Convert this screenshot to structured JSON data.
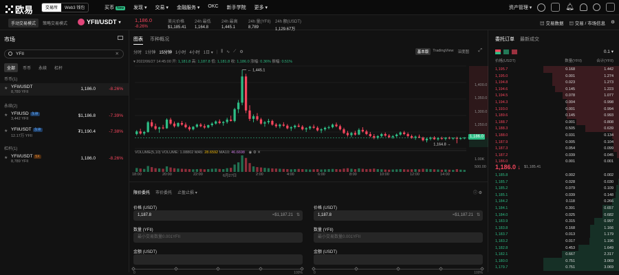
{
  "header": {
    "logo_text": "欧易",
    "toggle": [
      "交易所",
      "Web3 钱包"
    ],
    "nav": [
      "买币",
      "发现",
      "交易",
      "金融服务",
      "OKC",
      "新手学院",
      "更多"
    ],
    "nav_new_badge": "New",
    "right": [
      "资产管理"
    ]
  },
  "ticker": {
    "mode_active": "手动交易模式",
    "mode_other": "策略交易模式",
    "pair": "YFII/USDT",
    "last_price": "1,186.0",
    "change": "-8.26%",
    "stats": [
      {
        "k": "美元价格",
        "v": "$1,185.41"
      },
      {
        "k": "24h 最低",
        "v": "1,164.8"
      },
      {
        "k": "24h 最高",
        "v": "1,445.1"
      },
      {
        "k": "24h 量(YFII)",
        "v": "8,789"
      },
      {
        "k": "24h 额(USDT)",
        "v": "1,129.67万"
      }
    ],
    "links": [
      "交易数据",
      "交易 / 市场信息"
    ]
  },
  "market": {
    "title": "市场",
    "search_value": "YFII",
    "tabs": [
      "全部",
      "币币",
      "永续",
      "杠杆"
    ],
    "sections": [
      {
        "title": "币币(1)",
        "items": [
          {
            "name": "YFII/USDT",
            "tag": "",
            "vol": "8,789 YFII",
            "price": "1,186.0",
            "change": "-8.26%"
          }
        ]
      },
      {
        "title": "永续(2)",
        "items": [
          {
            "name": "YFIIUSD",
            "tag": "永续",
            "vol": "3,442 YFII",
            "price": "$1,186.8",
            "change": "-7.39%"
          },
          {
            "name": "YFIIUSDT",
            "tag": "永续",
            "vol": "12.17万 YFII",
            "price": "₮1,190.4",
            "change": "-7.38%"
          }
        ]
      },
      {
        "title": "杠杆(1)",
        "items": [
          {
            "name": "YFII/USDT",
            "tag": "5X",
            "vol": "8,789 YFII",
            "price": "1,186.0",
            "change": "-8.26%"
          }
        ]
      }
    ]
  },
  "chart": {
    "tabs": [
      "图表",
      "币种概况"
    ],
    "timeframes": [
      "分时",
      "1分钟",
      "15分钟",
      "1小时",
      "4小时",
      "1日"
    ],
    "views": [
      "基本版",
      "TradingView",
      "深度图"
    ],
    "ohlc_line": {
      "date": "2022/06/27 14:45:00",
      "open_k": "开",
      "open": "1,181.8",
      "high_k": "高",
      "high": "1,187.8",
      "low_k": "低",
      "low": "1,181.8",
      "close_k": "收",
      "close": "1,186.0",
      "chg_k": "涨幅",
      "chg": "0.36%",
      "amp_k": "振幅",
      "amp": "0.51%"
    },
    "vol_line": {
      "label": "VOLUME(5,10)",
      "vol_k": "VOLUME",
      "vol": "1.08802",
      "ma5_k": "MA5",
      "ma5": "28.6592",
      "ma10_k": "MA10",
      "ma10": "46.6698"
    },
    "high_marker": "1,445.1",
    "low_marker": "1,164.8",
    "current_price": "1,186.0",
    "price_ticks": [
      "1,400.0",
      "1,350.0",
      "1,300.0",
      "1,250.0",
      "1,200.0"
    ],
    "vol_ticks": [
      "1.00K",
      "500.00"
    ],
    "time_ticks": [
      "18:00",
      "20:00",
      "22:00",
      "6月27日",
      "2:00",
      "4:00",
      "6:00",
      "8:00",
      "10:00",
      "12:00",
      "14:00"
    ]
  },
  "chart_data": {
    "type": "candlestick",
    "title": "",
    "ylim": [
      1150,
      1460
    ],
    "candles": [
      [
        1200,
        1215,
        1195,
        1210
      ],
      [
        1210,
        1220,
        1198,
        1202
      ],
      [
        1202,
        1212,
        1195,
        1208
      ],
      [
        1208,
        1250,
        1205,
        1245
      ],
      [
        1245,
        1255,
        1225,
        1230
      ],
      [
        1230,
        1240,
        1215,
        1220
      ],
      [
        1220,
        1228,
        1205,
        1225
      ],
      [
        1225,
        1235,
        1218,
        1222
      ],
      [
        1222,
        1260,
        1220,
        1255
      ],
      [
        1255,
        1262,
        1235,
        1240
      ],
      [
        1240,
        1248,
        1225,
        1230
      ],
      [
        1230,
        1245,
        1226,
        1242
      ],
      [
        1242,
        1250,
        1232,
        1236
      ],
      [
        1236,
        1244,
        1222,
        1226
      ],
      [
        1226,
        1232,
        1212,
        1218
      ],
      [
        1218,
        1230,
        1214,
        1228
      ],
      [
        1228,
        1240,
        1224,
        1236
      ],
      [
        1236,
        1242,
        1226,
        1230
      ],
      [
        1230,
        1238,
        1220,
        1225
      ],
      [
        1225,
        1236,
        1222,
        1234
      ],
      [
        1234,
        1245,
        1228,
        1240
      ],
      [
        1240,
        1252,
        1236,
        1248
      ],
      [
        1248,
        1256,
        1238,
        1242
      ],
      [
        1242,
        1250,
        1232,
        1246
      ],
      [
        1246,
        1262,
        1240,
        1255
      ],
      [
        1255,
        1270,
        1248,
        1250
      ],
      [
        1250,
        1300,
        1245,
        1295
      ],
      [
        1295,
        1330,
        1280,
        1320
      ],
      [
        1320,
        1445,
        1310,
        1420
      ],
      [
        1420,
        1430,
        1280,
        1290
      ],
      [
        1290,
        1310,
        1250,
        1258
      ],
      [
        1258,
        1275,
        1245,
        1268
      ],
      [
        1268,
        1280,
        1250,
        1256
      ],
      [
        1256,
        1262,
        1236,
        1240
      ],
      [
        1240,
        1250,
        1228,
        1245
      ],
      [
        1245,
        1258,
        1238,
        1250
      ],
      [
        1250,
        1255,
        1232,
        1236
      ],
      [
        1236,
        1242,
        1224,
        1230
      ],
      [
        1230,
        1240,
        1222,
        1236
      ],
      [
        1236,
        1245,
        1228,
        1232
      ],
      [
        1232,
        1238,
        1218,
        1222
      ],
      [
        1222,
        1230,
        1212,
        1226
      ],
      [
        1226,
        1236,
        1220,
        1232
      ],
      [
        1232,
        1240,
        1226,
        1228
      ],
      [
        1228,
        1234,
        1214,
        1218
      ],
      [
        1218,
        1226,
        1208,
        1222
      ],
      [
        1222,
        1232,
        1216,
        1228
      ],
      [
        1228,
        1236,
        1220,
        1224
      ],
      [
        1224,
        1230,
        1210,
        1214
      ],
      [
        1214,
        1222,
        1204,
        1218
      ],
      [
        1218,
        1228,
        1212,
        1224
      ],
      [
        1224,
        1232,
        1218,
        1226
      ],
      [
        1226,
        1240,
        1222,
        1236
      ],
      [
        1236,
        1244,
        1226,
        1230
      ],
      [
        1230,
        1236,
        1214,
        1218
      ],
      [
        1218,
        1224,
        1200,
        1204
      ],
      [
        1204,
        1212,
        1190,
        1196
      ],
      [
        1196,
        1208,
        1188,
        1204
      ],
      [
        1204,
        1212,
        1194,
        1198
      ],
      [
        1198,
        1222,
        1196,
        1216
      ],
      [
        1216,
        1226,
        1206,
        1210
      ],
      [
        1210,
        1216,
        1196,
        1200
      ],
      [
        1200,
        1208,
        1188,
        1192
      ],
      [
        1192,
        1200,
        1180,
        1186
      ],
      [
        1186,
        1196,
        1180,
        1192
      ],
      [
        1192,
        1204,
        1186,
        1200
      ],
      [
        1200,
        1206,
        1190,
        1194
      ],
      [
        1194,
        1200,
        1184,
        1188
      ],
      [
        1188,
        1196,
        1182,
        1192
      ],
      [
        1192,
        1202,
        1188,
        1198
      ],
      [
        1198,
        1210,
        1194,
        1206
      ],
      [
        1206,
        1212,
        1196,
        1200
      ],
      [
        1200,
        1206,
        1188,
        1192
      ],
      [
        1192,
        1198,
        1182,
        1186
      ],
      [
        1186,
        1194,
        1178,
        1190
      ],
      [
        1190,
        1198,
        1184,
        1186
      ],
      [
        1186,
        1190,
        1172,
        1176
      ],
      [
        1176,
        1186,
        1168,
        1182
      ],
      [
        1182,
        1190,
        1176,
        1186
      ],
      [
        1186,
        1192,
        1178,
        1180
      ],
      [
        1180,
        1188,
        1175,
        1184
      ],
      [
        1184,
        1190,
        1178,
        1182
      ],
      [
        1182,
        1188,
        1176,
        1186
      ],
      [
        1186,
        1190,
        1180,
        1183
      ],
      [
        1183,
        1187,
        1178,
        1185
      ],
      [
        1185,
        1190,
        1164.8,
        1182
      ],
      [
        1182,
        1188,
        1178,
        1184
      ],
      [
        1184,
        1188,
        1180,
        1186
      ]
    ],
    "volume": [
      210,
      180,
      160,
      320,
      260,
      200,
      190,
      170,
      300,
      240,
      200,
      180,
      170,
      160,
      150,
      140,
      150,
      160,
      140,
      150,
      170,
      180,
      160,
      150,
      200,
      220,
      400,
      520,
      900,
      760,
      480,
      300,
      260,
      240,
      220,
      200,
      190,
      180,
      170,
      160,
      150,
      140,
      150,
      160,
      150,
      140,
      130,
      140,
      150,
      130,
      140,
      150,
      160,
      150,
      140,
      180,
      200,
      170,
      150,
      190,
      170,
      150,
      160,
      180,
      150,
      140,
      130,
      120,
      130,
      140,
      150,
      140,
      130,
      140,
      150,
      140,
      170,
      160,
      150,
      140,
      130,
      120,
      130,
      120,
      110,
      150,
      120,
      110
    ]
  },
  "order": {
    "tabs": [
      "限价委托",
      "市价委托",
      "止盈止损"
    ],
    "buy": {
      "price_label": "价格 (USDT)",
      "price": "1,187.8",
      "price_usd": "≈$1,187.21",
      "qty_label": "数量 (YFII)",
      "qty_placeholder": "最小交易数量0.001YFII",
      "amt_label": "金额 (USDT)"
    },
    "sell": {
      "price_label": "价格 (USDT)",
      "price": "1,187.8",
      "price_usd": "≈$1,187.21",
      "qty_label": "数量 (YFII)",
      "qty_placeholder": "最小交易数量0.001YFII",
      "amt_label": "金额 (USDT)"
    },
    "slider_min": "0",
    "slider_max": "100%"
  },
  "book": {
    "tabs": [
      "委托订单",
      "最新成交"
    ],
    "precision": "0.1",
    "headers": [
      "价格(USDT)",
      "数量(YFII)",
      "合计(YFII)"
    ],
    "asks": [
      [
        "1,195.7",
        "0.168",
        "1.442"
      ],
      [
        "1,195.0",
        "0.001",
        "1.274"
      ],
      [
        "1,194.8",
        "0.023",
        "1.273"
      ],
      [
        "1,194.6",
        "0.145",
        "1.223"
      ],
      [
        "1,194.5",
        "0.078",
        "1.077"
      ],
      [
        "1,194.3",
        "0.004",
        "0.998"
      ],
      [
        "1,193.0",
        "0.001",
        "0.994"
      ],
      [
        "1,189.6",
        "0.145",
        "0.993"
      ],
      [
        "1,188.7",
        "0.001",
        "0.808"
      ],
      [
        "1,188.3",
        "0.505",
        "0.639"
      ],
      [
        "1,188.0",
        "0.031",
        "0.134"
      ],
      [
        "1,187.9",
        "0.005",
        "0.104"
      ],
      [
        "1,187.3",
        "0.054",
        "0.099"
      ],
      [
        "1,187.2",
        "0.039",
        "0.045"
      ],
      [
        "1,186.0",
        "0.001",
        "0.001"
      ]
    ],
    "mid_price": "1,186.0",
    "mid_usd": "$1,185.41",
    "bids": [
      [
        "1,185.8",
        "0.002",
        "0.002"
      ],
      [
        "1,185.7",
        "0.028",
        "0.030"
      ],
      [
        "1,185.2",
        "0.079",
        "0.109"
      ],
      [
        "1,185.1",
        "0.039",
        "0.148"
      ],
      [
        "1,184.2",
        "0.118",
        "0.266"
      ],
      [
        "1,184.1",
        "0.391",
        "0.657"
      ],
      [
        "1,184.0",
        "0.025",
        "0.682"
      ],
      [
        "1,183.9",
        "0.315",
        "0.997"
      ],
      [
        "1,183.8",
        "0.168",
        "1.166"
      ],
      [
        "1,183.7",
        "0.013",
        "1.179"
      ],
      [
        "1,183.2",
        "0.017",
        "1.196"
      ],
      [
        "1,182.8",
        "0.453",
        "1.649"
      ],
      [
        "1,182.1",
        "0.667",
        "2.317"
      ],
      [
        "1,180.0",
        "0.751",
        "3.069"
      ],
      [
        "1,179.7",
        "0.751",
        "3.069"
      ]
    ]
  },
  "colors": {
    "up": "#2ebd85",
    "down": "#f6465d",
    "bg": "#121212"
  }
}
